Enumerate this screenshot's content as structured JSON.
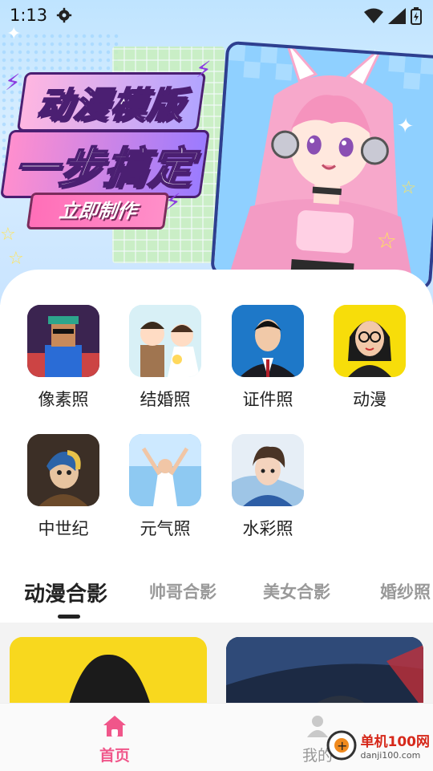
{
  "status_bar": {
    "time": "1:13"
  },
  "banner": {
    "title_line1": "动漫模版",
    "title_line2": "一步搞定",
    "cta_label": "立即制作"
  },
  "categories": [
    {
      "label": "像素照",
      "icon": "pixel-portrait"
    },
    {
      "label": "结婚照",
      "icon": "wedding-portrait"
    },
    {
      "label": "证件照",
      "icon": "id-portrait"
    },
    {
      "label": "动漫",
      "icon": "anime-portrait"
    },
    {
      "label": "中世纪",
      "icon": "medieval-portrait"
    },
    {
      "label": "元气照",
      "icon": "energetic-portrait"
    },
    {
      "label": "水彩照",
      "icon": "watercolor-portrait"
    }
  ],
  "tabs": [
    "动漫合影",
    "帅哥合影",
    "美女合影",
    "婚纱照"
  ],
  "active_tab": "动漫合影",
  "bottom_nav": {
    "home_label": "首页",
    "mine_label": "我的"
  },
  "watermark": {
    "text": "单机100网",
    "url": "danji100.com"
  },
  "colors": {
    "accent": "#f0568a",
    "active_text": "#222222",
    "inactive_text": "#999999"
  }
}
